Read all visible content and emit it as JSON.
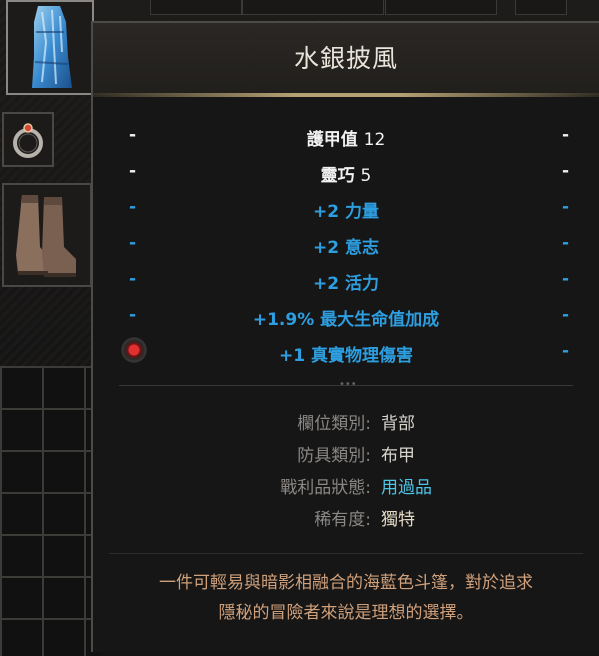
{
  "item": {
    "name": "水銀披風",
    "stats": [
      {
        "label": "護甲值",
        "value": "12",
        "color": "white"
      },
      {
        "label": "靈巧",
        "value": "5",
        "color": "white"
      },
      {
        "text": "+2 力量",
        "color": "blue"
      },
      {
        "text": "+2 意志",
        "color": "blue"
      },
      {
        "text": "+2 活力",
        "color": "blue"
      },
      {
        "text": "+1.9% 最大生命值加成",
        "color": "blue"
      },
      {
        "text": "+1 真實物理傷害",
        "color": "blue",
        "gem": true
      }
    ],
    "dash": "-",
    "properties": [
      {
        "label": "欄位類別:",
        "value": "背部"
      },
      {
        "label": "防具類別:",
        "value": "布甲"
      },
      {
        "label": "戰利品狀態:",
        "value": "用過品"
      },
      {
        "label": "稀有度:",
        "value": "獨特"
      }
    ],
    "description": [
      "一件可輕易與暗影相融合的海藍色斗篷，對於追求",
      "隱秘的冒險者來說是理想的選擇。"
    ]
  },
  "inventory": {
    "slots": [
      "cloak-slot",
      "ring-slot",
      "boots-slot"
    ]
  },
  "colors": {
    "white_stat": "#f2f2f2",
    "blue_stat": "#2d9ee0",
    "label_gray": "#8a8784",
    "loot_state": "#4ec5e6",
    "description": "#d0a07a",
    "title_rule": "#b5a274"
  }
}
